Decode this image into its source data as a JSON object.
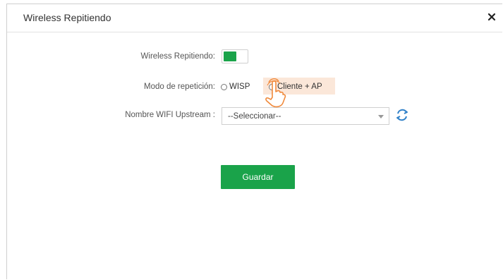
{
  "dialog": {
    "title": "Wireless Repitiendo",
    "close_icon": "close-icon"
  },
  "form": {
    "wireless_label": "Wireless Repitiendo:",
    "wireless_enabled": true,
    "mode_label": "Modo de repetición:",
    "mode_options": [
      "WISP",
      "Cliente + AP"
    ],
    "mode_selected": "Cliente + AP",
    "upstream_label": "Nombre WIFI Upstream :",
    "upstream_value": "--Seleccionar--",
    "refresh_icon": "refresh-icon"
  },
  "actions": {
    "save_label": "Guardar"
  },
  "colors": {
    "accent": "#1aa34a",
    "highlight": "#fbe7d9",
    "hand": "#f08a3c",
    "refresh": "#2f80c8"
  }
}
